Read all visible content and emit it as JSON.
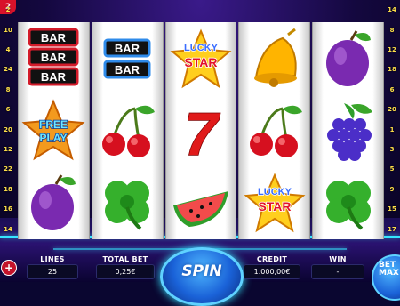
{
  "paylines": {
    "left": [
      "2",
      "10",
      "4",
      "24",
      "8",
      "6",
      "20",
      "12",
      "22",
      "18",
      "16",
      "14"
    ],
    "right": [
      "14",
      "8",
      "12",
      "18",
      "6",
      "20",
      "1",
      "3",
      "5",
      "9",
      "15",
      "17"
    ]
  },
  "reels": [
    [
      "triple-bar",
      "free-play-star",
      "plum"
    ],
    [
      "double-bar",
      "cherries",
      "clover"
    ],
    [
      "lucky-star",
      "seven",
      "watermelon"
    ],
    [
      "bell",
      "cherries",
      "lucky-star"
    ],
    [
      "plum",
      "grapes",
      "clover"
    ]
  ],
  "symbol_text": {
    "bar": "BAR",
    "free": "FREE",
    "play": "PLAY",
    "lucky": "LUCKY",
    "star": "STAR",
    "seven": "7"
  },
  "controls": {
    "lines_label": "LINES",
    "lines_value": "25",
    "total_bet_label": "TOTAL BET",
    "total_bet_value": "0,25€",
    "spin_label": "SPIN",
    "credit_label": "CREDIT",
    "credit_value": "1.000,00€",
    "win_label": "WIN",
    "win_value": "-",
    "bet_max_label": "BET MAX",
    "help_label": "+"
  },
  "colors": {
    "accent": "#35e6ff",
    "reel_bg": "#ffffff",
    "spin_blue": "#1a62d8",
    "payline_yellow": "#ffe14a"
  }
}
